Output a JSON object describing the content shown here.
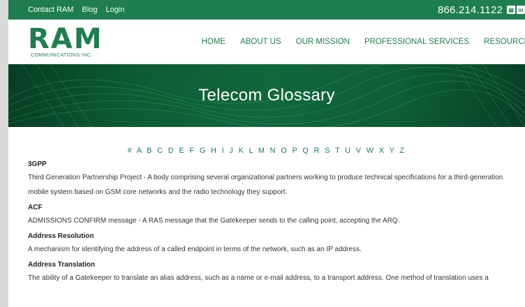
{
  "topbar": {
    "links": [
      "Contact RAM",
      "Blog",
      "Login"
    ],
    "phone": "866.214.1122",
    "social": [
      {
        "icon": "print-icon",
        "glyph": "▤"
      },
      {
        "icon": "linkedin-icon",
        "glyph": "in"
      }
    ]
  },
  "logo": {
    "mark": "RAM",
    "sub": "COMMUNICATIONS INC."
  },
  "nav": [
    "HOME",
    "ABOUT US",
    "OUR MISSION",
    "PROFESSIONAL SERVICES",
    "RESOURCES"
  ],
  "hero": {
    "title": "Telecom Glossary"
  },
  "alphabet": [
    "#",
    "A",
    "B",
    "C",
    "D",
    "E",
    "F",
    "G",
    "H",
    "I",
    "J",
    "K",
    "L",
    "M",
    "N",
    "O",
    "P",
    "Q",
    "R",
    "S",
    "T",
    "U",
    "V",
    "W",
    "X",
    "Y",
    "Z"
  ],
  "glossary": [
    {
      "term": "3GPP",
      "definition": "Third Generation Partnership Project - A body comprising several organizational partners working to produce technical specifications for a third-generation mobile system based on GSM core networks and the radio technology they support."
    },
    {
      "term": "ACF",
      "definition": "ADMISSIONS CONFIRM message - A RAS message that the Gatekeeper sends to the calling point, accepting the ARQ."
    },
    {
      "term": "Address Resolution",
      "definition": "A mechanism for identifying the address of a called endpoint in terms of the network, such as an IP address."
    },
    {
      "term": "Address Translation",
      "definition": "The ability of a Gatekeeper to translate an alias address, such as a name or e-mail address, to a transport address. One method of translation uses a"
    }
  ]
}
